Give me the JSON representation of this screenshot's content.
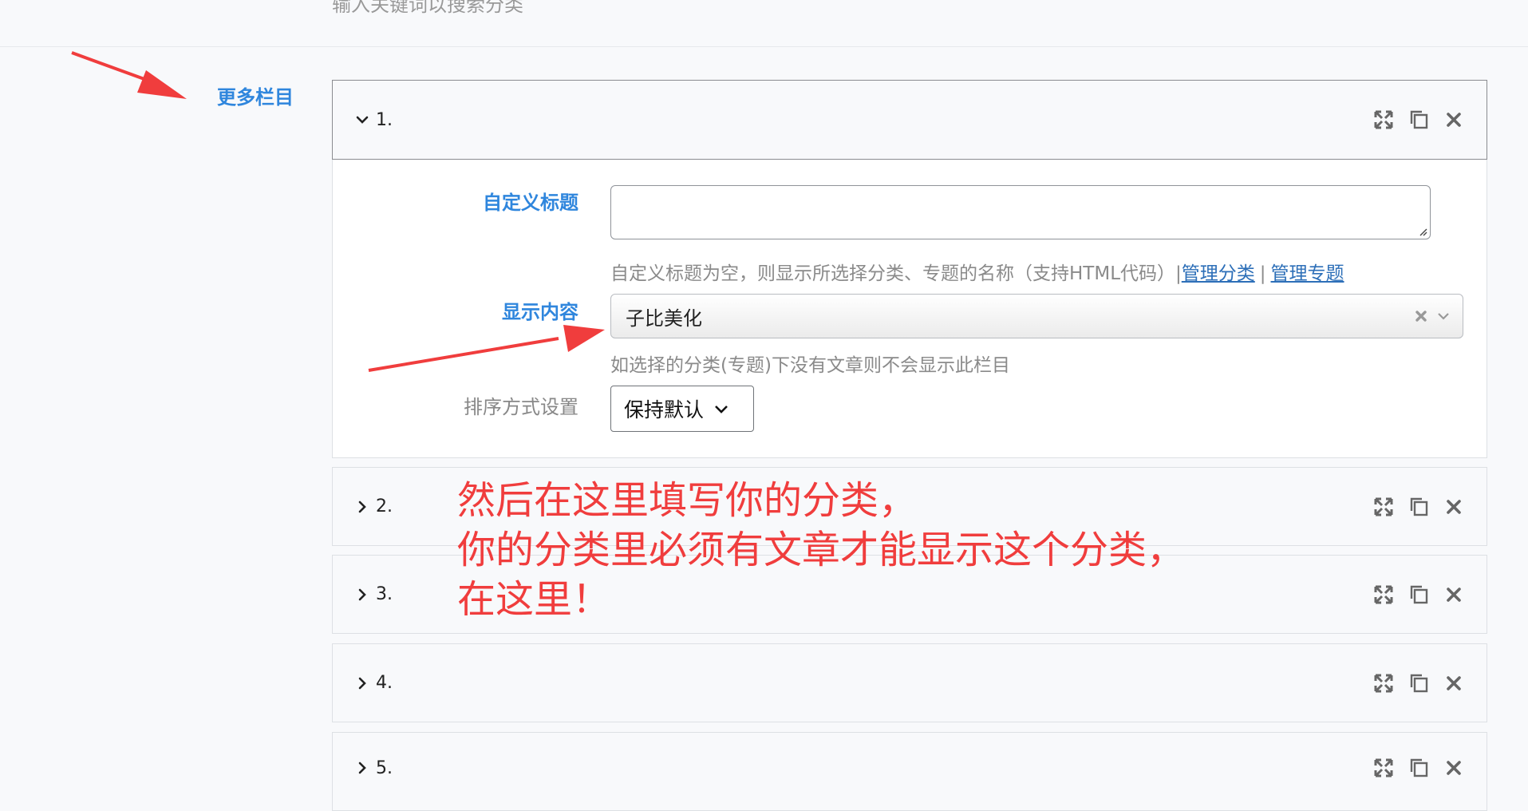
{
  "top_hint": "输入关键词以搜索分类",
  "section_label": "更多栏目",
  "panels": [
    {
      "num": "1.",
      "expanded": true
    },
    {
      "num": "2.",
      "expanded": false
    },
    {
      "num": "3.",
      "expanded": false
    },
    {
      "num": "4.",
      "expanded": false
    },
    {
      "num": "5.",
      "expanded": false
    }
  ],
  "panel_actions": [
    "expand-icon",
    "copy-icon",
    "close-icon"
  ],
  "form": {
    "title_label": "自定义标题",
    "title_value": "",
    "title_help": "自定义标题为空，则显示所选择分类、专题的名称（支持HTML代码）|",
    "link_manage_category": "管理分类",
    "link_separator": "|",
    "link_manage_topic": "管理专题",
    "content_label": "显示内容",
    "content_value": "子比美化",
    "content_help": "如选择的分类(专题)下没有文章则不会显示此栏目",
    "order_label": "排序方式设置",
    "order_value": "保持默认"
  },
  "annotation": {
    "line1": "然后在这里填写你的分类，",
    "line2": "你的分类里必须有文章才能显示这个分类，",
    "line3": "在这里！"
  },
  "colors": {
    "accent_blue": "#2f86dd",
    "annotation_red": "#f03d3d",
    "link_blue": "#2d6fb8"
  }
}
